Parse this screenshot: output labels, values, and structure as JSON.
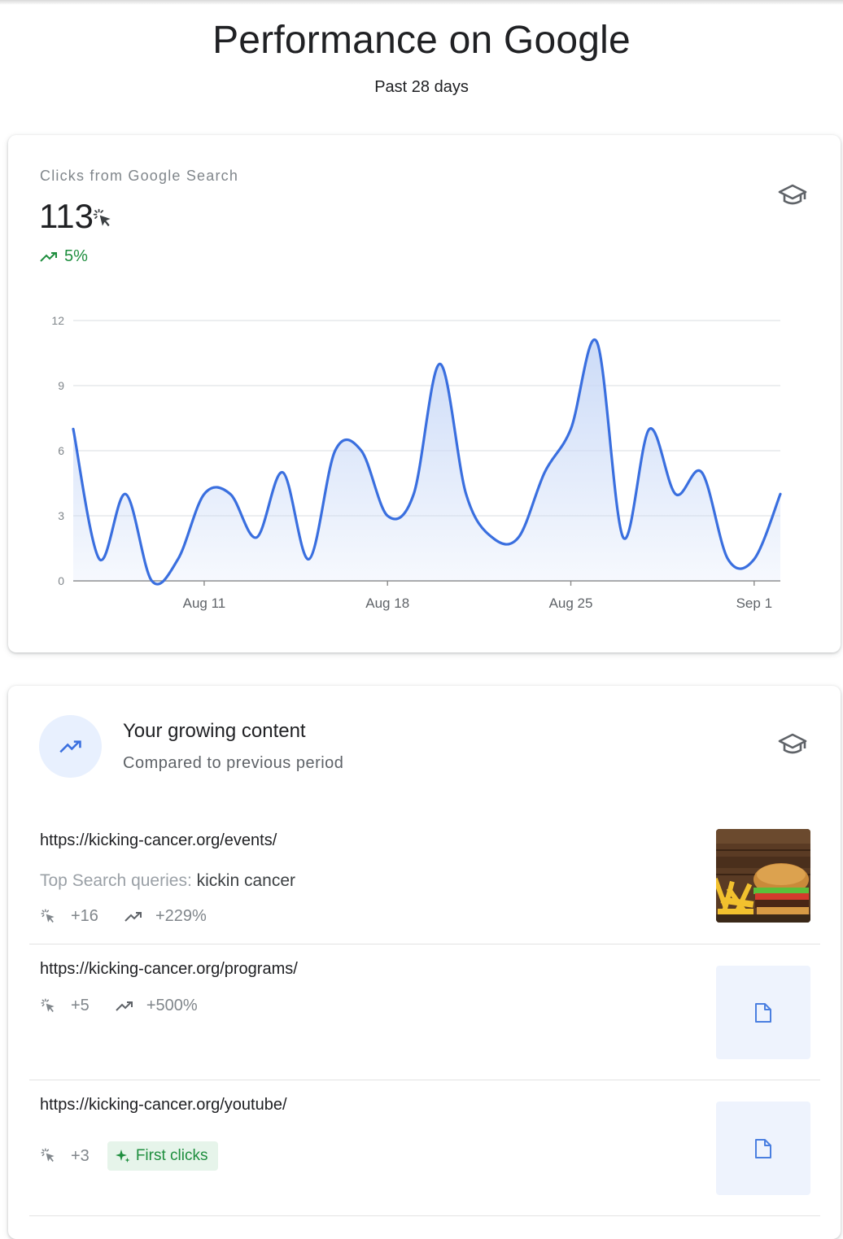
{
  "page": {
    "title": "Performance on Google",
    "subtitle": "Past 28 days"
  },
  "clicks_card": {
    "label": "Clicks from Google Search",
    "value": "113",
    "change": "5%",
    "value_icon": "click-icon",
    "learn_icon": "school-icon"
  },
  "chart_data": {
    "type": "area",
    "x": [
      "Aug 5",
      "Aug 6",
      "Aug 7",
      "Aug 8",
      "Aug 9",
      "Aug 10",
      "Aug 11",
      "Aug 12",
      "Aug 13",
      "Aug 14",
      "Aug 15",
      "Aug 16",
      "Aug 17",
      "Aug 18",
      "Aug 19",
      "Aug 20",
      "Aug 21",
      "Aug 22",
      "Aug 23",
      "Aug 24",
      "Aug 25",
      "Aug 26",
      "Aug 27",
      "Aug 28",
      "Aug 29",
      "Aug 30",
      "Aug 31",
      "Sep 1",
      "Sep 2"
    ],
    "values": [
      7,
      1,
      4,
      0,
      1,
      4,
      4,
      2,
      5,
      1,
      6,
      6,
      3,
      4,
      10,
      4,
      2,
      2,
      5,
      7,
      11,
      2,
      7,
      4,
      5,
      1,
      1,
      4
    ],
    "x_ticks": [
      "Aug 11",
      "Aug 18",
      "Aug 25",
      "Sep 1"
    ],
    "x_tick_index": [
      5,
      12,
      19,
      26
    ],
    "y_ticks": [
      0,
      3,
      6,
      9,
      12
    ],
    "ylim": [
      0,
      12
    ],
    "grid": true,
    "line_color": "#3a6fdf",
    "fill_color": "#c9d9f7"
  },
  "growing": {
    "title": "Your growing content",
    "subtitle": "Compared to previous period",
    "icon": "trending-up-icon",
    "queries_label": "Top Search queries:",
    "items": [
      {
        "url": "https://kicking-cancer.org/events/",
        "query": "kickin cancer",
        "clicks": "+16",
        "change": "+229%",
        "thumb": "burger-photo"
      },
      {
        "url": "https://kicking-cancer.org/programs/",
        "clicks": "+5",
        "change": "+500%",
        "thumb": "document-icon"
      },
      {
        "url": "https://kicking-cancer.org/youtube/",
        "clicks": "+3",
        "badge": "First clicks",
        "thumb": "document-icon"
      }
    ]
  },
  "colors": {
    "accent_blue": "#3a6fdf",
    "positive_green": "#1e8e3e",
    "chip_bg": "#e6f4ea",
    "muted": "#80868b"
  }
}
